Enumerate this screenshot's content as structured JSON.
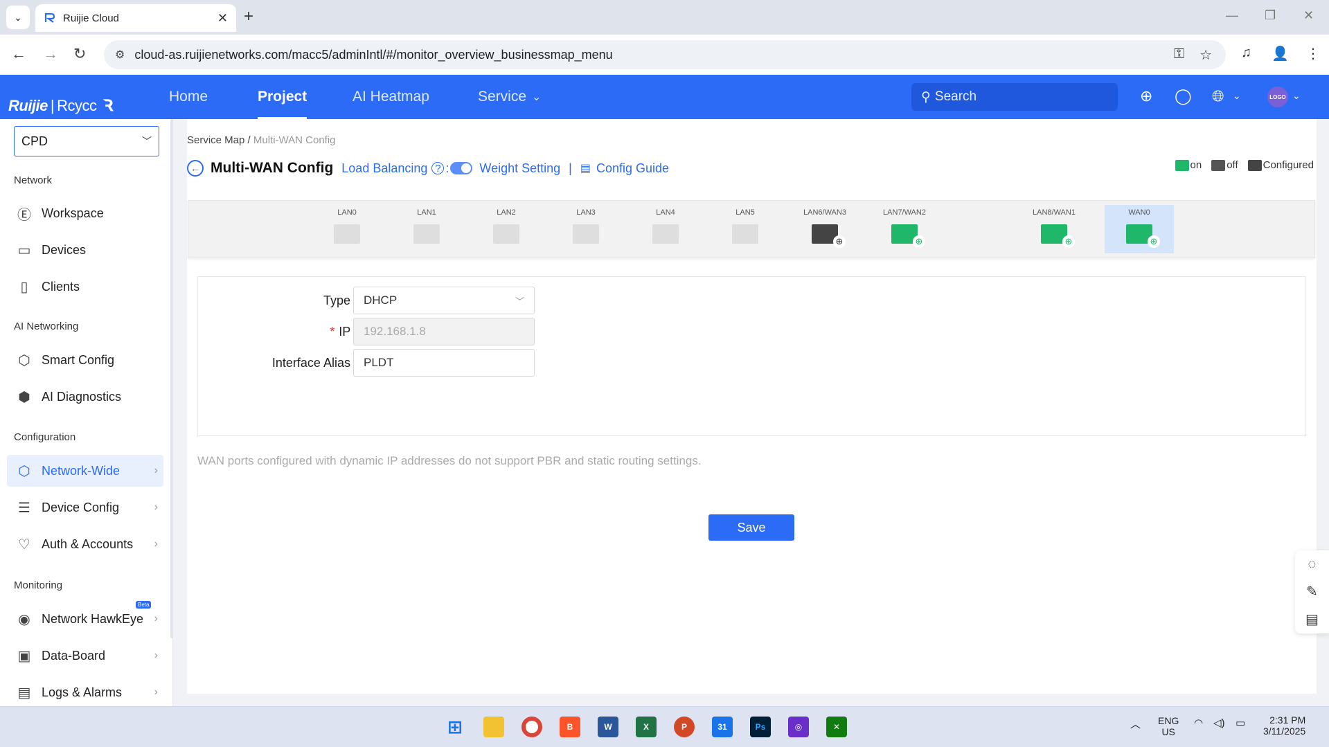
{
  "browser": {
    "tab_title": "Ruijie Cloud",
    "url": "cloud-as.ruijienetworks.com/macc5/adminIntl/#/monitor_overview_businessmap_menu"
  },
  "header": {
    "logo_text": "Ruijie",
    "logo_sub": "Rcycc",
    "nav": [
      {
        "label": "Home"
      },
      {
        "label": "Project"
      },
      {
        "label": "AI Heatmap"
      },
      {
        "label": "Service"
      }
    ],
    "search_placeholder": "Search",
    "avatar_text": "LOGO"
  },
  "sidebar": {
    "project": "CPD",
    "sections": {
      "network": "Network",
      "ai_networking": "AI Networking",
      "configuration": "Configuration",
      "monitoring": "Monitoring"
    },
    "items": [
      {
        "label": "Workspace"
      },
      {
        "label": "Devices"
      },
      {
        "label": "Clients"
      },
      {
        "label": "Smart Config"
      },
      {
        "label": "AI Diagnostics"
      },
      {
        "label": "Network-Wide"
      },
      {
        "label": "Device Config"
      },
      {
        "label": "Auth & Accounts"
      },
      {
        "label": "Network HawkEye"
      },
      {
        "label": "Data-Board"
      },
      {
        "label": "Logs & Alarms"
      }
    ],
    "beta": "Beta"
  },
  "page": {
    "breadcrumb_root": "Service Map /",
    "breadcrumb_current": "Multi-WAN Config",
    "title": "Multi-WAN Config",
    "load_balancing": "Load Balancing",
    "colon": ":",
    "weight_setting": "Weight Setting",
    "separator": "|",
    "config_guide": "Config Guide",
    "legend": {
      "on": "on",
      "off": "off",
      "configured": "Configured"
    },
    "ports": [
      {
        "label": "LAN0",
        "state": "off"
      },
      {
        "label": "LAN1",
        "state": "off"
      },
      {
        "label": "LAN2",
        "state": "off"
      },
      {
        "label": "LAN3",
        "state": "off"
      },
      {
        "label": "LAN4",
        "state": "off"
      },
      {
        "label": "LAN5",
        "state": "off"
      },
      {
        "label": "LAN6/WAN3",
        "state": "configured"
      },
      {
        "label": "LAN7/WAN2",
        "state": "on"
      },
      {
        "label": "LAN8/WAN1",
        "state": "on"
      },
      {
        "label": "WAN0",
        "state": "on"
      }
    ],
    "form": {
      "type_label": "Type",
      "type_value": "DHCP",
      "ip_label": "IP",
      "ip_value": "192.168.1.8",
      "alias_label": "Interface Alias",
      "alias_value": "PLDT",
      "label_colon": ":"
    },
    "hint": "WAN ports configured with dynamic IP addresses do not support PBR and static routing settings.",
    "save_label": "Save"
  },
  "taskbar": {
    "lang": "ENG",
    "region": "US",
    "time": "2:31 PM",
    "date": "3/11/2025"
  },
  "colors": {
    "brand": "#2b6bf5",
    "port_on": "#1fb86b",
    "port_off": "#dedede",
    "port_configured": "#444444"
  }
}
